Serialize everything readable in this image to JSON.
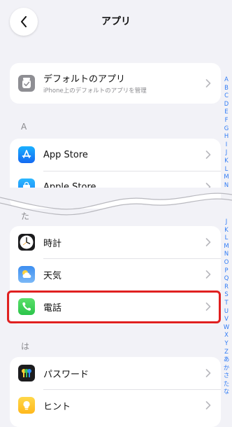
{
  "header": {
    "title": "アプリ",
    "back_icon": "chevron-left-icon"
  },
  "default_apps": {
    "title": "デフォルトのアプリ",
    "subtitle": "iPhone上のデフォルトのアプリを管理",
    "icon": "default-apps-icon"
  },
  "section_a": {
    "header": "A",
    "items": [
      {
        "label": "App Store",
        "icon": "app-store-icon"
      },
      {
        "label": "Apple Store",
        "icon": "apple-store-icon"
      }
    ]
  },
  "section_ta": {
    "header": "た",
    "items": [
      {
        "label": "時計",
        "icon": "clock-icon"
      },
      {
        "label": "天気",
        "icon": "weather-icon"
      },
      {
        "label": "電話",
        "icon": "phone-icon"
      }
    ]
  },
  "section_ha": {
    "header": "は",
    "items": [
      {
        "label": "パスワード",
        "icon": "passwords-icon"
      },
      {
        "label": "ヒント",
        "icon": "tips-icon"
      }
    ]
  },
  "index_upper": [
    "A",
    "B",
    "C",
    "D",
    "E",
    "F",
    "G",
    "H",
    "I",
    "J",
    "K",
    "L",
    "M",
    "N"
  ],
  "index_lower": [
    "J",
    "K",
    "L",
    "M",
    "N",
    "O",
    "P",
    "Q",
    "R",
    "S",
    "T",
    "U",
    "V",
    "W",
    "X",
    "Y",
    "Z",
    "あ",
    "か",
    "さ",
    "た",
    "な"
  ],
  "colors": {
    "accent": "#2f7bf6",
    "highlight": "#e02020",
    "background": "#f2f2f7"
  }
}
